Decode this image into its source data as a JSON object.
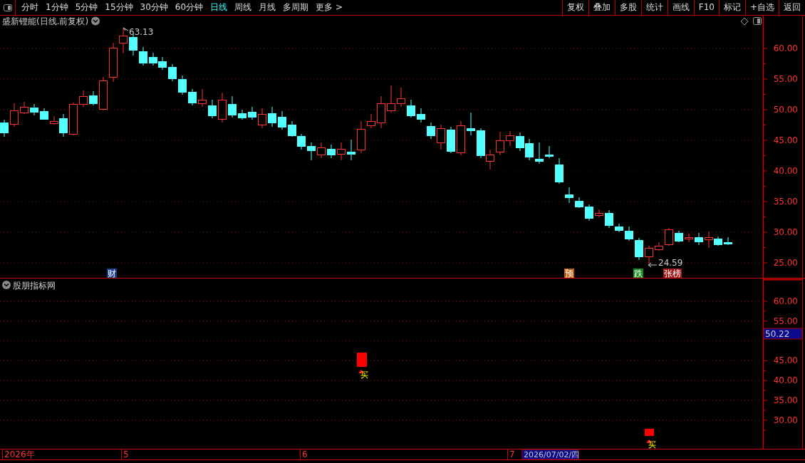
{
  "toolbar": {
    "periods": [
      {
        "label": "分时",
        "selected": false
      },
      {
        "label": "1分钟",
        "selected": false
      },
      {
        "label": "5分钟",
        "selected": false
      },
      {
        "label": "15分钟",
        "selected": false
      },
      {
        "label": "30分钟",
        "selected": false
      },
      {
        "label": "60分钟",
        "selected": false
      },
      {
        "label": "日线",
        "selected": true
      },
      {
        "label": "周线",
        "selected": false
      },
      {
        "label": "月线",
        "selected": false
      },
      {
        "label": "多周期",
        "selected": false
      },
      {
        "label": "更多 >",
        "selected": false
      }
    ],
    "actions": [
      "复权",
      "叠加",
      "多股",
      "统计",
      "画线",
      "F10",
      "标记",
      "+自选",
      "返回"
    ]
  },
  "main_chart": {
    "title": "盛新锂能(日线.前复权)",
    "high_label": "63.13",
    "low_label": "24.59",
    "y_axis_labels": [
      "60.00",
      "55.00",
      "50.00",
      "45.00",
      "40.00",
      "35.00",
      "30.00",
      "25.00"
    ],
    "event_tags": [
      {
        "label": "财",
        "color": "#1a3a8a"
      },
      {
        "label": "预",
        "color": "#c05a10"
      },
      {
        "label": "跌",
        "color": "#138a20"
      },
      {
        "label": "张榜",
        "color": "#a01818"
      }
    ]
  },
  "indicator_panel": {
    "title": "股朋指标网",
    "cursor_value": "50.22",
    "y_axis_labels": [
      "60.00",
      "55.00",
      "45.00",
      "40.00",
      "35.00",
      "30.00"
    ],
    "signals": [
      {
        "label": "买"
      },
      {
        "label": "买"
      }
    ]
  },
  "time_axis": {
    "labels": [
      "2026年",
      "5",
      "6",
      "7"
    ],
    "cursor_date": "2026/07/02/四"
  }
}
